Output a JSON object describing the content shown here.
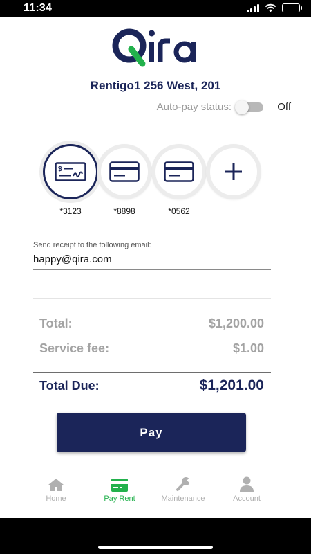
{
  "status_bar": {
    "time": "11:34",
    "battery_level": 1.0
  },
  "brand": {
    "logo_text": "Qira",
    "navy": "#1b2559",
    "green": "#22b14c"
  },
  "property": {
    "name": "Rentigo1 256 West, 201"
  },
  "autopay": {
    "label": "Auto-pay status:",
    "state": "Off"
  },
  "payment_methods": [
    {
      "icon": "check-icon",
      "label": "*3123",
      "selected": true
    },
    {
      "icon": "credit-card-icon",
      "label": "*8898",
      "selected": false
    },
    {
      "icon": "credit-card-icon",
      "label": "*0562",
      "selected": false
    },
    {
      "icon": "plus-icon",
      "label": "",
      "selected": false
    }
  ],
  "email": {
    "label": "Send receipt to the following email:",
    "value": "happy@qira.com"
  },
  "summary": {
    "total_label": "Total:",
    "total_value": "$1,200.00",
    "fee_label": "Service fee:",
    "fee_value": "$1.00",
    "due_label": "Total Due:",
    "due_value": "$1,201.00"
  },
  "pay_button": {
    "label": "Pay"
  },
  "tabs": [
    {
      "icon": "home-icon",
      "label": "Home",
      "active": false
    },
    {
      "icon": "payment-card-icon",
      "label": "Pay Rent",
      "active": true
    },
    {
      "icon": "wrench-icon",
      "label": "Maintenance",
      "active": false
    },
    {
      "icon": "person-icon",
      "label": "Account",
      "active": false
    }
  ]
}
